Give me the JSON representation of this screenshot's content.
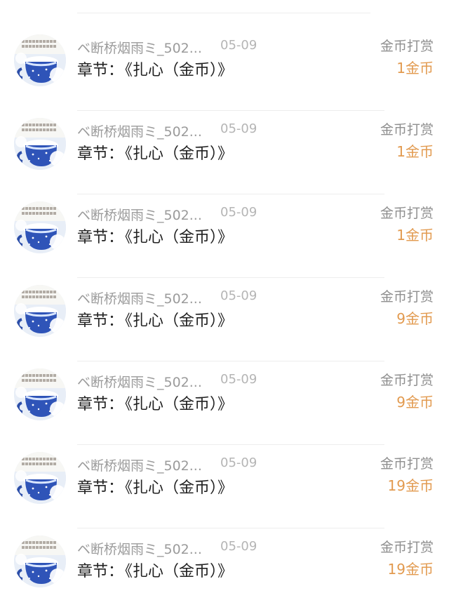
{
  "rewards": {
    "items": [
      {
        "username": "ベ断桥烟雨ミ_502...",
        "date": "05-09",
        "chapter_label": "章节：",
        "chapter_title": "《扎心（金币）》",
        "reward_label": "金币打赏",
        "amount": "1金币",
        "avatar_icon": "blue-cup-snow-avatar"
      },
      {
        "username": "ベ断桥烟雨ミ_502...",
        "date": "05-09",
        "chapter_label": "章节：",
        "chapter_title": "《扎心（金币）》",
        "reward_label": "金币打赏",
        "amount": "1金币",
        "avatar_icon": "blue-cup-snow-avatar"
      },
      {
        "username": "ベ断桥烟雨ミ_502...",
        "date": "05-09",
        "chapter_label": "章节：",
        "chapter_title": "《扎心（金币）》",
        "reward_label": "金币打赏",
        "amount": "1金币",
        "avatar_icon": "blue-cup-snow-avatar"
      },
      {
        "username": "ベ断桥烟雨ミ_502...",
        "date": "05-09",
        "chapter_label": "章节：",
        "chapter_title": "《扎心（金币）》",
        "reward_label": "金币打赏",
        "amount": "9金币",
        "avatar_icon": "blue-cup-snow-avatar"
      },
      {
        "username": "ベ断桥烟雨ミ_502...",
        "date": "05-09",
        "chapter_label": "章节：",
        "chapter_title": "《扎心（金币）》",
        "reward_label": "金币打赏",
        "amount": "9金币",
        "avatar_icon": "blue-cup-snow-avatar"
      },
      {
        "username": "ベ断桥烟雨ミ_502...",
        "date": "05-09",
        "chapter_label": "章节：",
        "chapter_title": "《扎心（金币）》",
        "reward_label": "金币打赏",
        "amount": "19金币",
        "avatar_icon": "blue-cup-snow-avatar"
      },
      {
        "username": "ベ断桥烟雨ミ_502...",
        "date": "05-09",
        "chapter_label": "章节：",
        "chapter_title": "《扎心（金币）》",
        "reward_label": "金币打赏",
        "amount": "19金币",
        "avatar_icon": "blue-cup-snow-avatar"
      }
    ]
  },
  "colors": {
    "username": "#9b9b9b",
    "date": "#b5b5b5",
    "chapter": "#222222",
    "reward_label": "#8f8f8f",
    "amount": "#e29a4f",
    "divider": "#ededed",
    "avatar_blue": "#2f54b8"
  }
}
